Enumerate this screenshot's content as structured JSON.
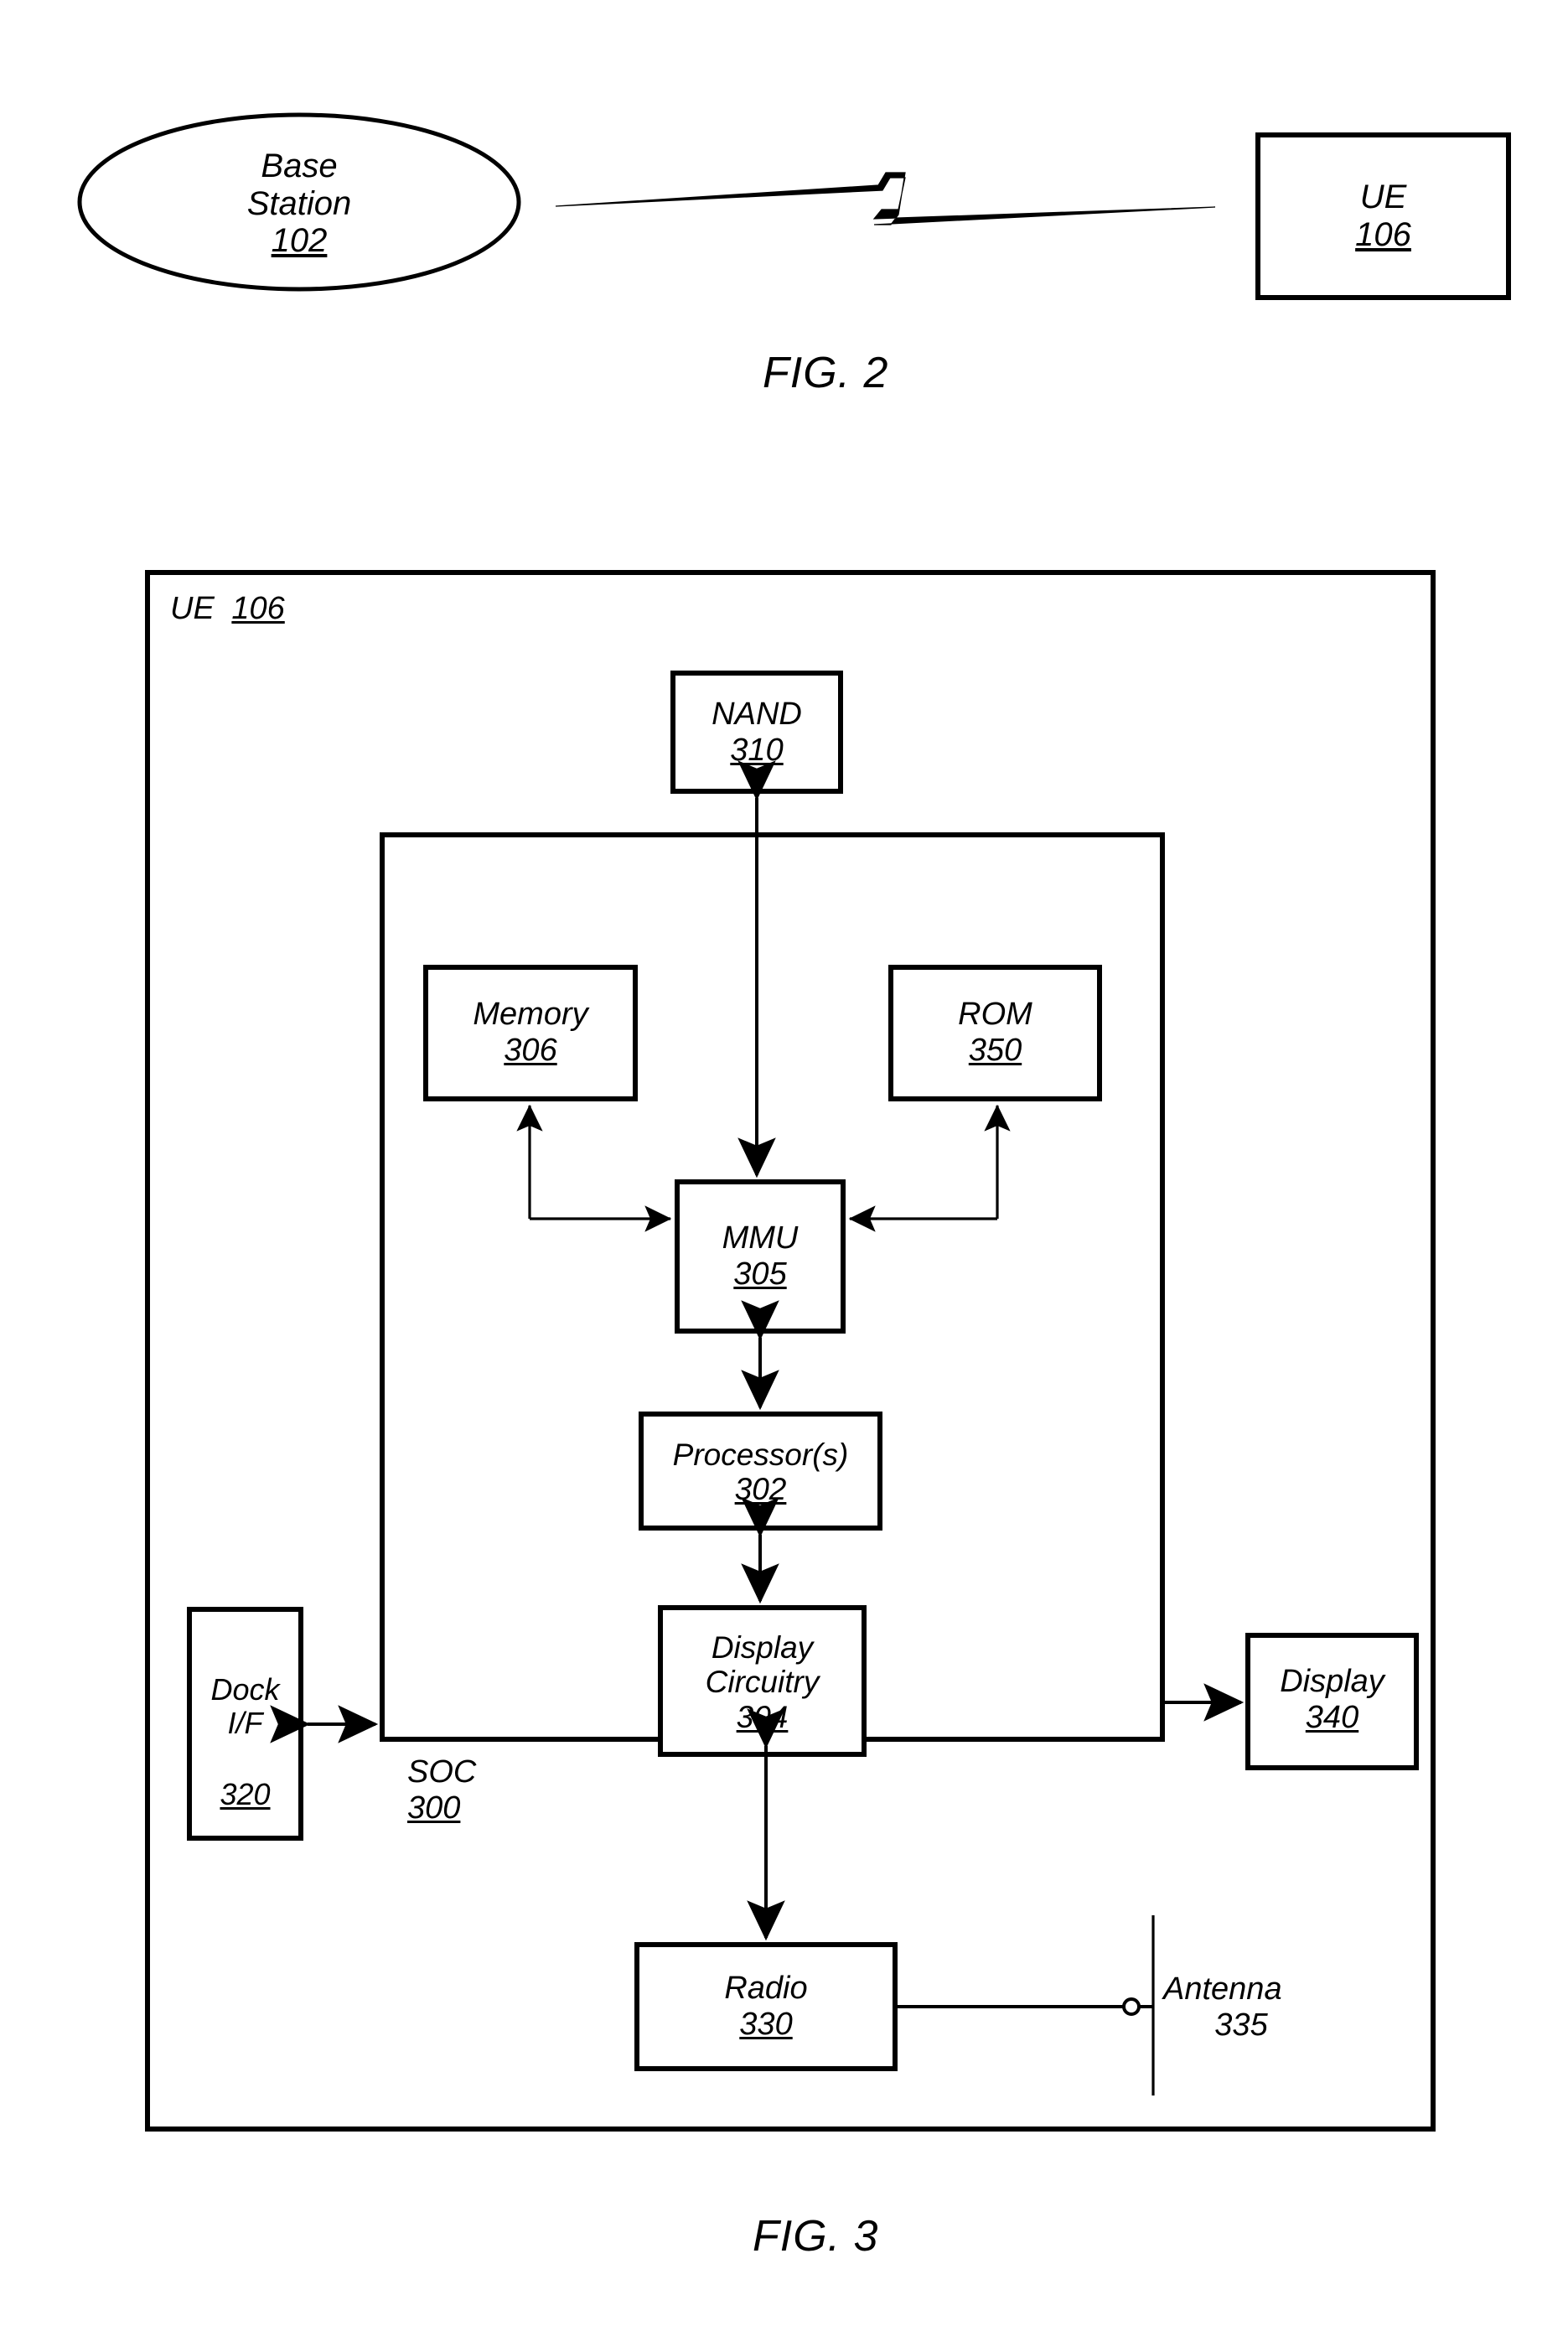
{
  "figures": [
    {
      "id": "fig2",
      "caption": "FIG. 2",
      "nodes": [
        {
          "name": "base-station",
          "shape": "ellipse",
          "lines": [
            "Base",
            "Station"
          ],
          "ref": "102",
          "ref_underlined": true
        },
        {
          "name": "ue",
          "shape": "rect",
          "lines": [
            "UE"
          ],
          "ref": "106",
          "ref_underlined": true
        }
      ],
      "links": [
        {
          "name": "wireless-link",
          "type": "lightning-bolt",
          "from": "base-station",
          "to": "ue"
        }
      ]
    },
    {
      "id": "fig3",
      "caption": "FIG. 3",
      "containers": [
        {
          "name": "ue-boundary",
          "label": "UE",
          "ref": "106",
          "ref_underlined": true
        },
        {
          "name": "soc-boundary",
          "label": "SOC",
          "ref": "300",
          "ref_underlined": true
        }
      ],
      "nodes": [
        {
          "name": "nand",
          "lines": [
            "NAND"
          ],
          "ref": "310",
          "ref_underlined": true
        },
        {
          "name": "memory",
          "lines": [
            "Memory"
          ],
          "ref": "306",
          "ref_underlined": true
        },
        {
          "name": "rom",
          "lines": [
            "ROM"
          ],
          "ref": "350",
          "ref_underlined": true
        },
        {
          "name": "mmu",
          "lines": [
            "MMU"
          ],
          "ref": "305",
          "ref_underlined": true
        },
        {
          "name": "processors",
          "lines": [
            "Processor(s)"
          ],
          "ref": "302",
          "ref_underlined": true
        },
        {
          "name": "display-circuitry",
          "lines": [
            "Display",
            "Circuitry"
          ],
          "ref": "304",
          "ref_underlined": true
        },
        {
          "name": "dock-if",
          "lines": [
            "Dock",
            "I/F"
          ],
          "ref": "320",
          "ref_underlined": true
        },
        {
          "name": "display",
          "lines": [
            "Display"
          ],
          "ref": "340",
          "ref_underlined": true
        },
        {
          "name": "radio",
          "lines": [
            "Radio"
          ],
          "ref": "330",
          "ref_underlined": true
        },
        {
          "name": "antenna",
          "lines": [
            "Antenna"
          ],
          "ref": "335",
          "ref_underlined": false
        }
      ],
      "links": [
        {
          "name": "nand-mmu-link",
          "from": "nand",
          "to": "mmu",
          "arrows": "both"
        },
        {
          "name": "memory-mmu-link",
          "from": "memory",
          "to": "mmu",
          "arrows": "both",
          "routing": "elbow"
        },
        {
          "name": "rom-mmu-link",
          "from": "rom",
          "to": "mmu",
          "arrows": "both",
          "routing": "elbow"
        },
        {
          "name": "mmu-processors-link",
          "from": "mmu",
          "to": "processors",
          "arrows": "both"
        },
        {
          "name": "processors-display-circuitry-link",
          "from": "processors",
          "to": "display-circuitry",
          "arrows": "both"
        },
        {
          "name": "dock-soc-link",
          "from": "dock-if",
          "to": "soc-boundary",
          "arrows": "both"
        },
        {
          "name": "soc-display-link",
          "from": "soc-boundary",
          "to": "display",
          "arrows": "single"
        },
        {
          "name": "soc-radio-link",
          "from": "soc-boundary",
          "to": "radio",
          "arrows": "both"
        },
        {
          "name": "radio-antenna-link",
          "from": "radio",
          "to": "antenna",
          "arrows": "none"
        }
      ]
    }
  ],
  "fig2": {
    "base_station": {
      "line1": "Base",
      "line2": "Station",
      "ref": "102"
    },
    "ue": {
      "line1": "UE",
      "ref": "106"
    },
    "caption": "FIG. 2"
  },
  "fig3": {
    "ue_label": "UE",
    "ue_ref": "106",
    "soc_label": "SOC",
    "soc_ref": "300",
    "nand": {
      "line1": "NAND",
      "ref": "310"
    },
    "memory": {
      "line1": "Memory",
      "ref": "306"
    },
    "rom": {
      "line1": "ROM",
      "ref": "350"
    },
    "mmu": {
      "line1": "MMU",
      "ref": "305"
    },
    "processors": {
      "line1": "Processor(s)",
      "ref": "302"
    },
    "display_circuitry": {
      "line1": "Display",
      "line2": "Circuitry",
      "ref": "304"
    },
    "dock_if": {
      "line1": "Dock",
      "line2": "I/F",
      "ref": "320"
    },
    "display": {
      "line1": "Display",
      "ref": "340"
    },
    "radio": {
      "line1": "Radio",
      "ref": "330"
    },
    "antenna": {
      "line1": "Antenna",
      "ref": "335"
    },
    "caption": "FIG. 3"
  },
  "colors": {
    "ink": "#000000",
    "paper": "#ffffff"
  }
}
